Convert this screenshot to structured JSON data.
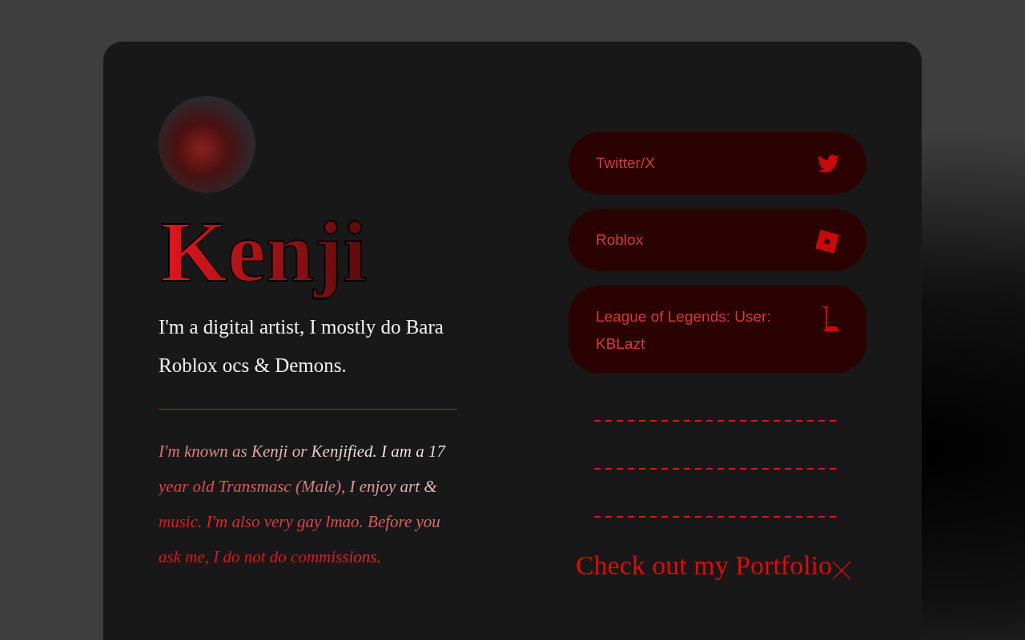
{
  "profile": {
    "name": "Kenji",
    "tagline": "I'm a digital artist, I mostly do Bara Roblox ocs & Demons.",
    "bio": "I'm known as Kenji or Kenjified. I am a 17 year old Transmasc (Male), I enjoy art & music. I'm also very gay lmao. Before you ask me, I do not do commissions."
  },
  "links": [
    {
      "kind": "twitter",
      "label": "Twitter/X"
    },
    {
      "kind": "roblox",
      "label": "Roblox"
    },
    {
      "kind": "league",
      "label": "League of Legends: User: KBLazt"
    }
  ],
  "portfolio": {
    "label": "Check out my Portfolio"
  }
}
